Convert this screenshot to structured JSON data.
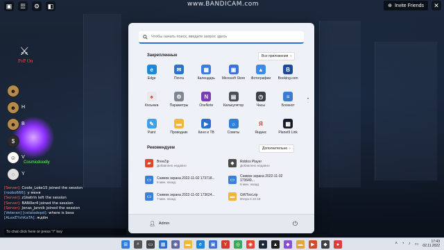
{
  "overlay": {
    "watermark": "www.BANDICAM.com",
    "invite_label": "Invite Friends"
  },
  "game": {
    "pvp_label": "PvP On",
    "player_name": "Cosmicdoodly",
    "ability_keys": [
      "",
      "H",
      "B",
      "",
      "V",
      "Y"
    ],
    "chat": [
      {
        "prefix": "[Server]:",
        "text": "Coole_Loke15 joined the session",
        "kind": "server"
      },
      {
        "prefix": "[roobo666]:",
        "text": "у меня",
        "kind": "user"
      },
      {
        "prefix": "[Server]:",
        "text": "z1ketrin left the session",
        "kind": "server"
      },
      {
        "prefix": "[Server]:",
        "text": "BAN0er4 joined the session",
        "kind": "server"
      },
      {
        "prefix": "[Server]:",
        "text": "Jonas_Jannik joined the session",
        "kind": "server"
      },
      {
        "prefix": "[Veteran] [celaladepd]:",
        "text": "where is boss",
        "kind": "user"
      },
      {
        "prefix": "[ALexEYshKaTA]:",
        "text": "ждём",
        "kind": "user"
      }
    ],
    "chat_placeholder": "To chat click here or press \"/\" key"
  },
  "start_menu": {
    "search_placeholder": "Чтобы начать поиск, введите запрос здесь",
    "pinned_title": "Закрепленные",
    "all_apps_label": "Все приложения",
    "pinned": [
      {
        "label": "Edge",
        "icon": "edge-icon",
        "color": "#1e88d6",
        "glyph": "e"
      },
      {
        "label": "Почта",
        "icon": "mail-icon",
        "color": "#2a73c9",
        "glyph": "✉"
      },
      {
        "label": "Календарь",
        "icon": "calendar-icon",
        "color": "#3a7be0",
        "glyph": "▦"
      },
      {
        "label": "Microsoft Store",
        "icon": "store-icon",
        "color": "#3f6fd8",
        "glyph": "▣"
      },
      {
        "label": "Фотографии",
        "icon": "photos-icon",
        "color": "#3c8be6",
        "glyph": "▲"
      },
      {
        "label": "Booking.com",
        "icon": "booking-icon",
        "color": "#1a4a99",
        "glyph": "B"
      },
      {
        "label": "Косынка",
        "icon": "solitaire-icon",
        "color": "#e8e8e8",
        "glyph": "♠"
      },
      {
        "label": "Параметры",
        "icon": "settings-icon",
        "color": "#7d8794",
        "glyph": "⚙"
      },
      {
        "label": "OneNote",
        "icon": "onenote-icon",
        "color": "#7b3bb5",
        "glyph": "N"
      },
      {
        "label": "Калькулятор",
        "icon": "calculator-icon",
        "color": "#4a4f58",
        "glyph": "▤"
      },
      {
        "label": "Часы",
        "icon": "clock-icon",
        "color": "#3a3f48",
        "glyph": "◷"
      },
      {
        "label": "Блокнот",
        "icon": "notepad-icon",
        "color": "#3a7bd5",
        "glyph": "≡"
      },
      {
        "label": "Paint",
        "icon": "paint-icon",
        "color": "#3da0e8",
        "glyph": "✎"
      },
      {
        "label": "Проводник",
        "icon": "explorer-icon",
        "color": "#f2b83a",
        "glyph": "▬"
      },
      {
        "label": "Кино и ТВ",
        "icon": "movies-icon",
        "color": "#2a6fd0",
        "glyph": "▶"
      },
      {
        "label": "Советы",
        "icon": "tips-icon",
        "color": "#2f7fd8",
        "glyph": "☼"
      },
      {
        "label": "Яндекс",
        "icon": "yandex-icon",
        "color": "#f3f3f3",
        "glyph": "Я"
      },
      {
        "label": "Planet9 Link",
        "icon": "planet9-icon",
        "color": "#151b2a",
        "glyph": "▩"
      }
    ],
    "recommended_title": "Рекомендуем",
    "more_label": "Дополнительно",
    "recommended": [
      {
        "name": "BreeZip",
        "sub": "Добавлено недавно",
        "icon": "breezip-icon",
        "color": "#e0452e",
        "glyph": "▰"
      },
      {
        "name": "Roblox Player",
        "sub": "Добавлено недавно",
        "icon": "roblox-icon",
        "color": "#4a4a4a",
        "glyph": "◆"
      },
      {
        "name": "Снимок экрана 2022-11-02 173718...",
        "sub": "6 мин. назад",
        "icon": "image-file-icon",
        "color": "#3b7ee0",
        "glyph": "▭"
      },
      {
        "name": "Снимок экрана 2022-11-02 173649...",
        "sub": "6 мин. назад",
        "icon": "image-file-icon",
        "color": "#3b7ee0",
        "glyph": "▭"
      },
      {
        "name": "Снимок экрана 2022-11-02 173624...",
        "sub": "7 мин. назад",
        "icon": "image-file-icon",
        "color": "#3b7ee0",
        "glyph": "▭"
      },
      {
        "name": "GWTool.zip",
        "sub": "Вчера в 22:18",
        "icon": "zip-folder-icon",
        "color": "#efb63a",
        "glyph": "▬"
      }
    ],
    "user_name": "Admin"
  },
  "taskbar": {
    "apps": [
      {
        "icon": "start-icon",
        "color": "#2f7be0",
        "glyph": "⊞"
      },
      {
        "icon": "search-icon",
        "color": "#555555",
        "glyph": "⌕"
      },
      {
        "icon": "task-view-icon",
        "color": "#444444",
        "glyph": "▭"
      },
      {
        "icon": "widgets-icon",
        "color": "#2a6fd0",
        "glyph": "▦"
      },
      {
        "icon": "chat-icon",
        "color": "#6264a7",
        "glyph": "◉"
      },
      {
        "icon": "explorer-icon",
        "color": "#f2b83a",
        "glyph": "▬"
      },
      {
        "icon": "edge-icon",
        "color": "#1e88d6",
        "glyph": "e"
      },
      {
        "icon": "store-icon",
        "color": "#3f6fd8",
        "glyph": "▣"
      },
      {
        "icon": "yandex-icon",
        "color": "#d33a2c",
        "glyph": "Y"
      },
      {
        "icon": "chrome-icon",
        "color": "#3aa757",
        "glyph": "◎"
      },
      {
        "icon": "browser-icon",
        "color": "#e6452e",
        "glyph": "◉"
      },
      {
        "icon": "steam-icon",
        "color": "#1b2838",
        "glyph": "●"
      },
      {
        "icon": "epic-icon",
        "color": "#202020",
        "glyph": "▲"
      },
      {
        "icon": "vpn-icon",
        "color": "#8a4dd6",
        "glyph": "◆"
      },
      {
        "icon": "folder-icon",
        "color": "#e6a53a",
        "glyph": "▬"
      },
      {
        "icon": "media-player-icon",
        "color": "#d24a2a",
        "glyph": "▶"
      },
      {
        "icon": "roblox-icon",
        "color": "#404040",
        "glyph": "◆"
      },
      {
        "icon": "bandicam-icon",
        "color": "#d84040",
        "glyph": "●"
      }
    ],
    "time": "17:43",
    "date": "02.11.2022"
  }
}
